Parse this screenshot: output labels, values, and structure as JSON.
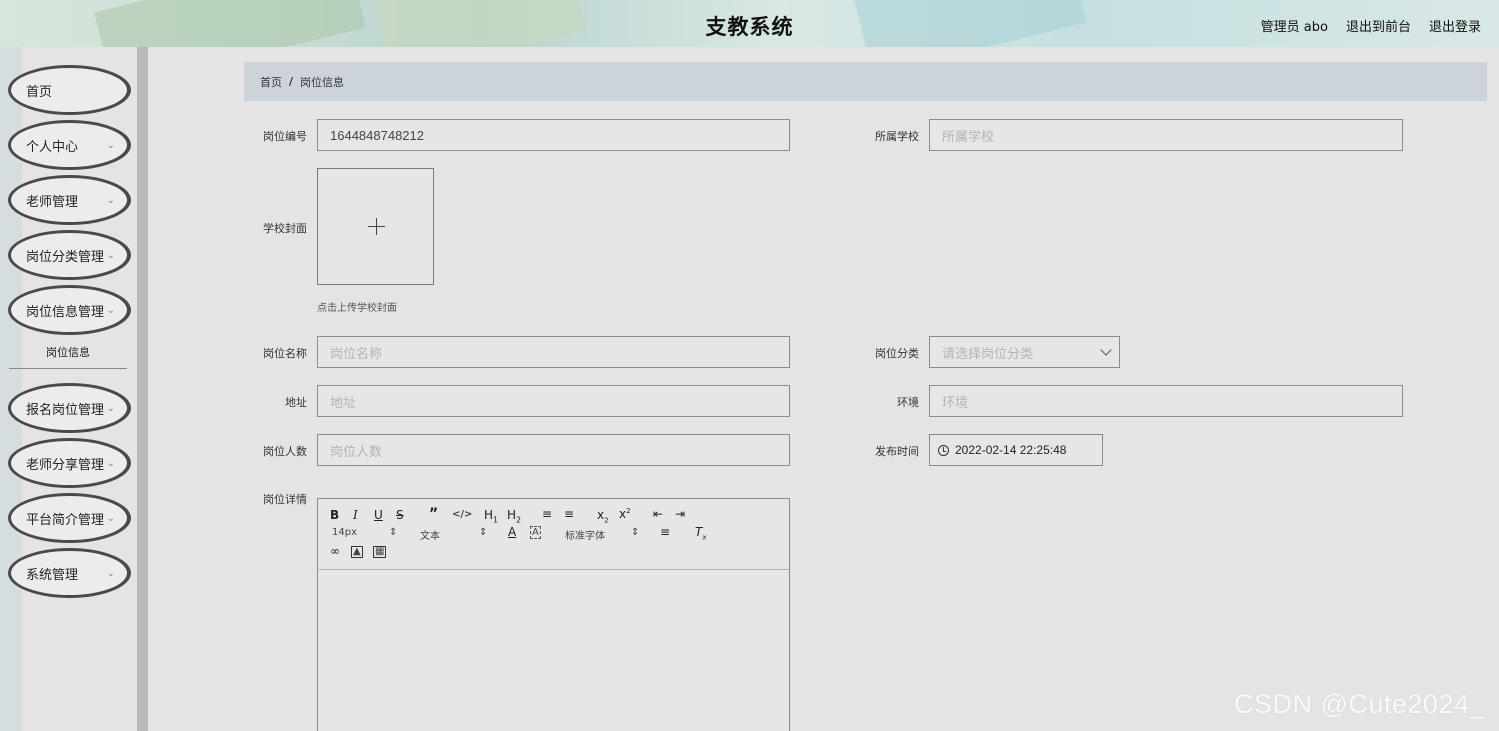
{
  "header": {
    "title": "支教系统",
    "user_label": "管理员 abo",
    "exit_front_label": "退出到前台",
    "logout_label": "退出登录"
  },
  "sidebar": {
    "items": [
      {
        "label": "首页"
      },
      {
        "label": "个人中心"
      },
      {
        "label": "老师管理"
      },
      {
        "label": "岗位分类管理"
      },
      {
        "label": "岗位信息管理"
      },
      {
        "label": "报名岗位管理"
      },
      {
        "label": "老师分享管理"
      },
      {
        "label": "平台简介管理"
      },
      {
        "label": "系统管理"
      }
    ],
    "subitem": "岗位信息"
  },
  "breadcrumb": {
    "home": "首页",
    "sep": "/",
    "current": "岗位信息"
  },
  "form": {
    "job_no": {
      "label": "岗位编号",
      "value": "1644848748212"
    },
    "school": {
      "label": "所属学校",
      "placeholder": "所属学校"
    },
    "cover": {
      "label": "学校封面",
      "hint": "点击上传学校封面"
    },
    "job_name": {
      "label": "岗位名称",
      "placeholder": "岗位名称"
    },
    "job_category": {
      "label": "岗位分类",
      "placeholder": "请选择岗位分类"
    },
    "address": {
      "label": "地址",
      "placeholder": "地址"
    },
    "environment": {
      "label": "环境",
      "placeholder": "环境"
    },
    "headcount": {
      "label": "岗位人数",
      "placeholder": "岗位人数"
    },
    "publish_time": {
      "label": "发布时间",
      "value": "2022-02-14 22:25:48"
    },
    "details": {
      "label": "岗位详情"
    }
  },
  "editor": {
    "font_size": "14px",
    "text_style": "文本",
    "font_family": "标准字体"
  },
  "watermark": "CSDN @Cute2024_",
  "colors": {
    "breadcrumb_bg": "#ccd4d9",
    "page_bg": "#e4e4e4"
  }
}
